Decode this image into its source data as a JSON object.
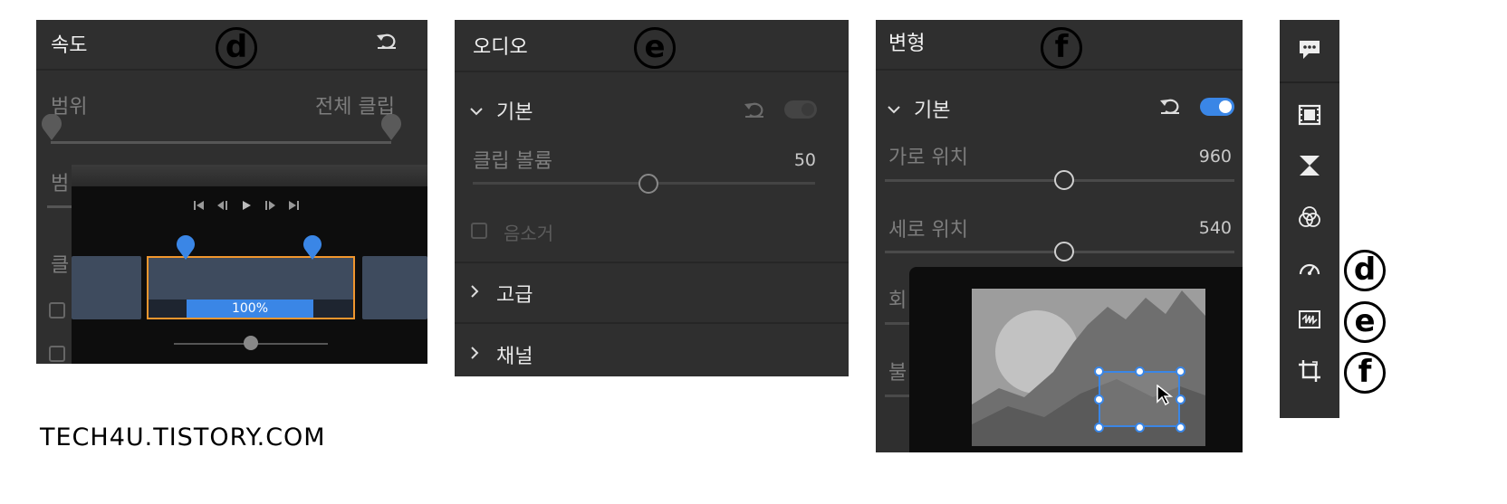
{
  "speed": {
    "letter": "d",
    "title": "속도",
    "range_label": "범위",
    "range_value": "전체 클립",
    "partial_label1": "범",
    "partial_label2": "클",
    "speed_value": "100%"
  },
  "audio": {
    "letter": "e",
    "title": "오디오",
    "basic": "기본",
    "clip_volume_label": "클립 볼륨",
    "clip_volume_value": "50",
    "clip_volume_level": 0.5,
    "mute_label": "음소거",
    "advanced": "고급",
    "channel": "채널"
  },
  "transform": {
    "letter": "f",
    "title": "변형",
    "basic": "기본",
    "hpos_label": "가로 위치",
    "hpos_value": "960",
    "vpos_label": "세로 위치",
    "vpos_value": "540",
    "partial_label1": "회",
    "partial_label2": "불"
  },
  "sidebar": {
    "icons": [
      "comment-icon",
      "film-icon",
      "transition-icon",
      "color-icon",
      "speedometer-icon",
      "audio-wave-icon",
      "crop-icon"
    ],
    "letters": [
      "d",
      "e",
      "f"
    ]
  },
  "footer": {
    "watermark": "TECH4U.TISTORY.COM"
  },
  "colors": {
    "accent": "#3a86e6",
    "orange": "#f0962e",
    "panel": "#2f2f2f"
  }
}
